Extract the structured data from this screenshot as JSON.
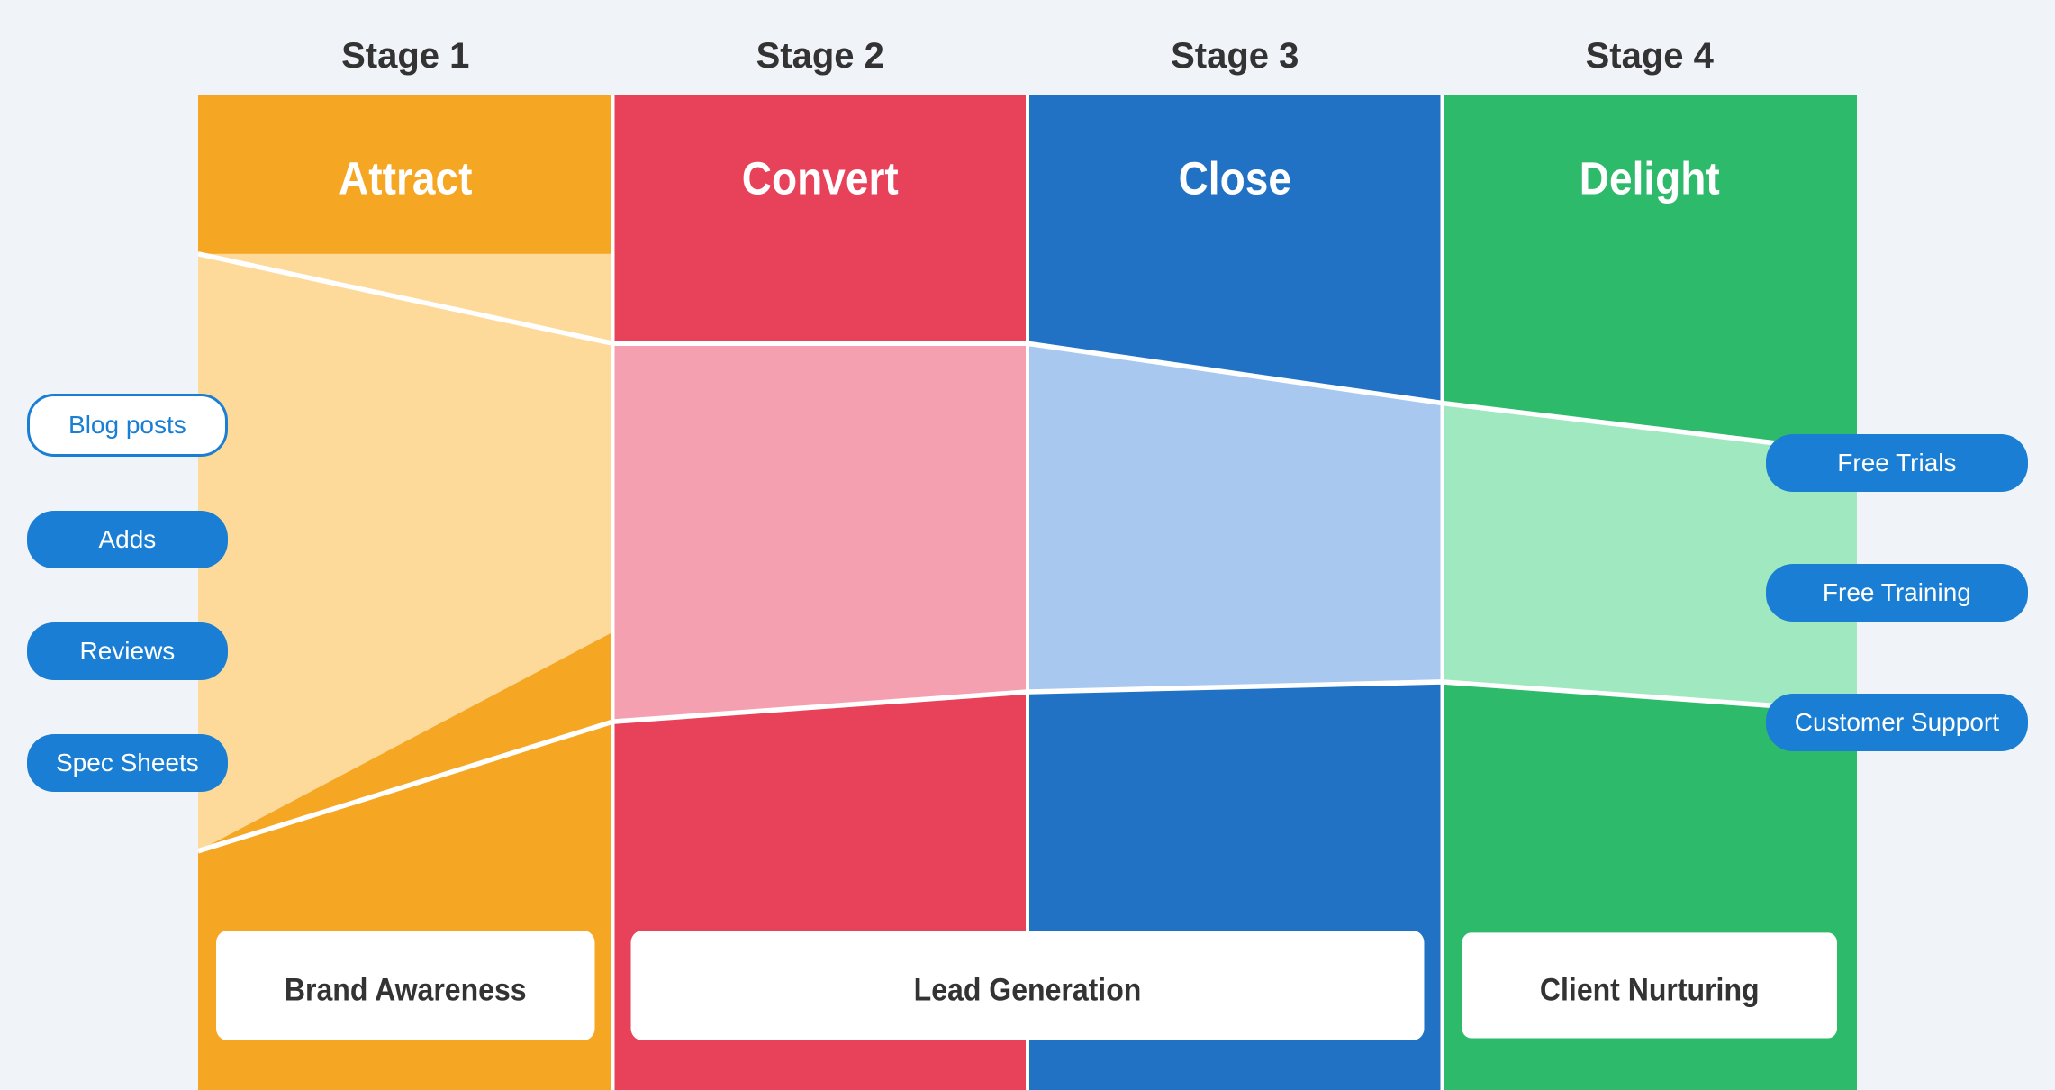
{
  "stages": [
    {
      "label": "Stage 1",
      "color": "#f5a623",
      "title": "Attract",
      "title_color": "white"
    },
    {
      "label": "Stage 2",
      "color": "#e8415a",
      "title": "Convert",
      "title_color": "white"
    },
    {
      "label": "Stage 3",
      "color": "#2172c4",
      "title": "Close",
      "title_color": "white"
    },
    {
      "label": "Stage 4",
      "color": "#2dba6b",
      "title": "Delight",
      "title_color": "white"
    }
  ],
  "left_buttons": [
    {
      "label": "Blog posts",
      "selected": true
    },
    {
      "label": "Adds",
      "selected": false
    },
    {
      "label": "Reviews",
      "selected": false
    },
    {
      "label": "Spec Sheets",
      "selected": false
    }
  ],
  "right_buttons": [
    {
      "label": "Free Trials",
      "selected": false
    },
    {
      "label": "Free Training",
      "selected": false
    },
    {
      "label": "Customer Support",
      "selected": false
    }
  ],
  "bottom_labels": [
    {
      "label": "Brand Awareness",
      "border_color": "#f5a623"
    },
    {
      "label": "Lead Generation",
      "border_color": "#e8415a"
    },
    {
      "label": "Client Nurturing",
      "border_color": "#2dba6b"
    }
  ],
  "colors": {
    "attract_dark": "#f5a623",
    "attract_light": "#fdd99a",
    "convert_dark": "#e8415a",
    "convert_light": "#f5a0a8",
    "close_dark": "#2172c4",
    "close_light": "#a8c8f0",
    "delight_dark": "#2dba6b",
    "delight_light": "#a0e8c0",
    "button_blue": "#1a7fd4",
    "button_selected_bg": "white",
    "button_selected_text": "#1a7fd4"
  }
}
